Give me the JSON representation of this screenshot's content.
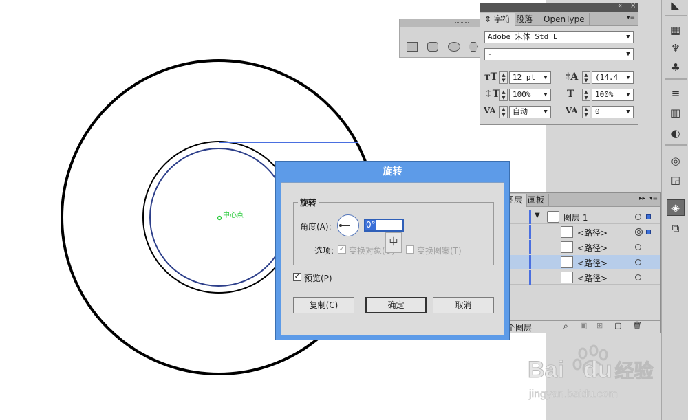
{
  "canvas": {
    "center_point_label": "中心点"
  },
  "char_panel": {
    "tabs": [
      "字符",
      "段落",
      "OpenType"
    ],
    "font_family": "Adobe 宋体 Std L",
    "font_style": "-",
    "font_size": "12 pt",
    "leading": "(14.4",
    "vertical_scale": "100%",
    "horizontal_scale": "100%",
    "kerning": "自动",
    "tracking": "0",
    "collapse_glyph": "«",
    "close_glyph": "×",
    "menu_glyph": "▾≡"
  },
  "layers_panel": {
    "tabs": [
      "图层",
      "画板"
    ],
    "layer_name": "图层 1",
    "items": [
      {
        "name": "<路径>",
        "selected": false
      },
      {
        "name": "<路径>",
        "selected": false
      },
      {
        "name": "<路径>",
        "selected": true
      },
      {
        "name": "<路径>",
        "selected": false
      }
    ],
    "footer_label": "个图层"
  },
  "rotate_dialog": {
    "title": "旋转",
    "group_label": "旋转",
    "angle_label": "角度(A):",
    "angle_value": "0°",
    "options_label": "选项:",
    "transform_objects": "变换对象(O)",
    "transform_patterns": "变换图案(T)",
    "ime_char": "中",
    "preview_label": "预览(P)",
    "preview_checked": true,
    "copy_button": "复制(C)",
    "ok_button": "确定",
    "cancel_button": "取消"
  },
  "watermark": {
    "brand": "Bai",
    "brand2": "du",
    "suffix": "经验",
    "url": "jingyan.baidu.com"
  },
  "colors": {
    "dialog_title": "#5d9be8",
    "selection_blue": "#3b6fd8",
    "center_point": "#2ecc40"
  }
}
